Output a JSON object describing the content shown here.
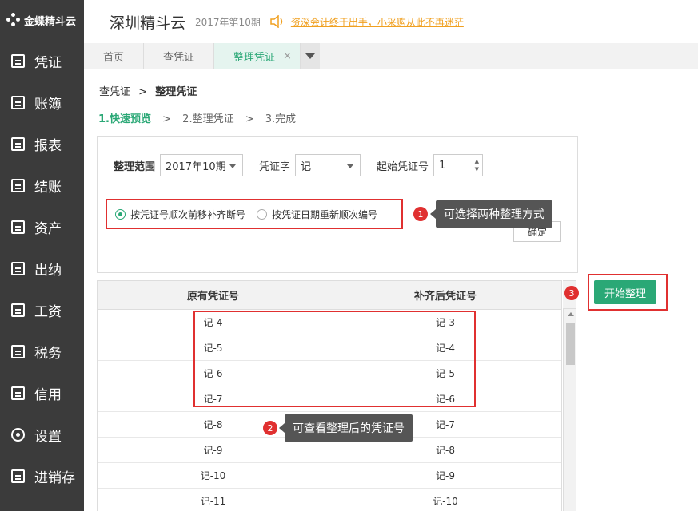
{
  "logo": {
    "text": "金蝶精斗云"
  },
  "sidebar": {
    "items": [
      {
        "label": "凭证"
      },
      {
        "label": "账簿"
      },
      {
        "label": "报表"
      },
      {
        "label": "结账"
      },
      {
        "label": "资产"
      },
      {
        "label": "出纳"
      },
      {
        "label": "工资"
      },
      {
        "label": "税务"
      },
      {
        "label": "信用"
      },
      {
        "label": "设置"
      },
      {
        "label": "进销存"
      }
    ]
  },
  "header": {
    "company": "深圳精斗云",
    "period": "2017年第10期",
    "notice": "资深会计终于出手，小采购从此不再迷茫"
  },
  "tabs": [
    {
      "label": "首页"
    },
    {
      "label": "查凭证"
    },
    {
      "label": "整理凭证",
      "close": "×"
    }
  ],
  "breadcrumb": {
    "parent": "查凭证",
    "sep": ">",
    "current": "整理凭证"
  },
  "steps": {
    "s1": "1.快速预览",
    "s2": "2.整理凭证",
    "s3": "3.完成",
    "sep": ">"
  },
  "form": {
    "range_label": "整理范围",
    "range_value": "2017年10期",
    "word_label": "凭证字",
    "word_value": "记",
    "start_label": "起始凭证号",
    "start_value": "1",
    "radio1": "按凭证号顺次前移补齐断号",
    "radio2": "按凭证日期重新顺次编号",
    "confirm": "确定"
  },
  "callouts": {
    "c1_num": "1",
    "c1_text": "可选择两种整理方式",
    "c2_num": "2",
    "c2_text": "可查看整理后的凭证号",
    "c3_num": "3"
  },
  "table": {
    "col1": "原有凭证号",
    "col2": "补齐后凭证号",
    "rows": [
      [
        "记-4",
        "记-3"
      ],
      [
        "记-5",
        "记-4"
      ],
      [
        "记-6",
        "记-5"
      ],
      [
        "记-7",
        "记-6"
      ],
      [
        "记-8",
        "记-7"
      ],
      [
        "记-9",
        "记-8"
      ],
      [
        "记-10",
        "记-9"
      ],
      [
        "记-11",
        "记-10"
      ]
    ]
  },
  "start_button": "开始整理",
  "colors": {
    "accent": "#2aa876",
    "highlight": "#e03030",
    "sidebar": "#3b3b3b"
  }
}
